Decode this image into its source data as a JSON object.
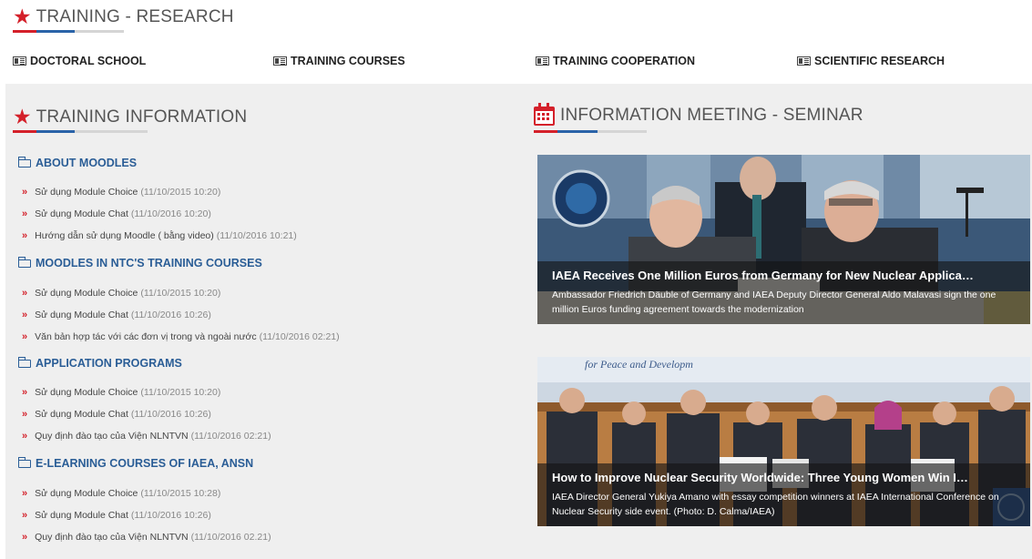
{
  "section_header": "TRAINING - RESEARCH",
  "nav": [
    {
      "label": "DOCTORAL SCHOOL"
    },
    {
      "label": "TRAINING COURSES"
    },
    {
      "label": "TRAINING COOPERATION"
    },
    {
      "label": "SCIENTIFIC RESEARCH"
    }
  ],
  "training_info": {
    "title": "TRAINING INFORMATION",
    "categories": [
      {
        "name": "ABOUT MOODLES",
        "items": [
          {
            "text": "Sử dụng Module Choice",
            "date": "(11/10/2015 10:20)"
          },
          {
            "text": "Sử dụng Module Chat",
            "date": "(11/10/2016 10:20)"
          },
          {
            "text": "Hướng dẫn sử dụng Moodle ( bằng video)",
            "date": "(11/10/2016 10:21)"
          }
        ]
      },
      {
        "name": "MOODLES IN NTC'S TRAINING COURSES",
        "items": [
          {
            "text": "Sử dụng Module Choice",
            "date": "(11/10/2015 10:20)"
          },
          {
            "text": "Sử dụng Module Chat",
            "date": "(11/10/2016 10:26)"
          },
          {
            "text": "Văn bản hợp tác với các đơn vị trong và ngoài nước",
            "date": "(11/10/2016 02:21)"
          }
        ]
      },
      {
        "name": "APPLICATION PROGRAMS",
        "items": [
          {
            "text": "Sử dụng Module Choice",
            "date": "(11/10/2015 10:20)"
          },
          {
            "text": "Sử dụng Module Chat",
            "date": "(11/10/2016 10:26)"
          },
          {
            "text": "Quy định đào tạo của Viện NLNTVN",
            "date": "(11/10/2016 02:21)"
          }
        ]
      },
      {
        "name": "E-LEARNING COURSES OF IAEA, ANSN",
        "items": [
          {
            "text": "Sử dụng Module Choice",
            "date": "(11/10/2015 10:28)"
          },
          {
            "text": "Sử dụng Module Chat",
            "date": "(11/10/2016 10:26)"
          },
          {
            "text": "Quy định đào tạo của Viện NLNTVN",
            "date": "(11/10/2016 02.21)"
          }
        ]
      }
    ]
  },
  "meeting": {
    "title": "INFORMATION MEETING - SEMINAR",
    "news": [
      {
        "title": "IAEA Receives One Million Euros from Germany for New Nuclear Applica…",
        "desc": "Ambassador Friedrich Däuble of Germany and IAEA Deputy Director General Aldo Malavasi sign the one million Euros funding agreement towards the modernization"
      },
      {
        "title": "How to Improve Nuclear Security Worldwide: Three Young Women Win I…",
        "desc": "IAEA Director General Yukiya Amano with essay competition winners at IAEA International Conference on Nuclear Security side event. (Photo: D. Calma/IAEA)",
        "photo_banner": "for Peace and Developm"
      }
    ]
  },
  "colors": {
    "accent_red": "#d4202a",
    "accent_blue": "#2a63a8",
    "link_blue": "#2a5d96",
    "panel_bg": "#efefef"
  }
}
